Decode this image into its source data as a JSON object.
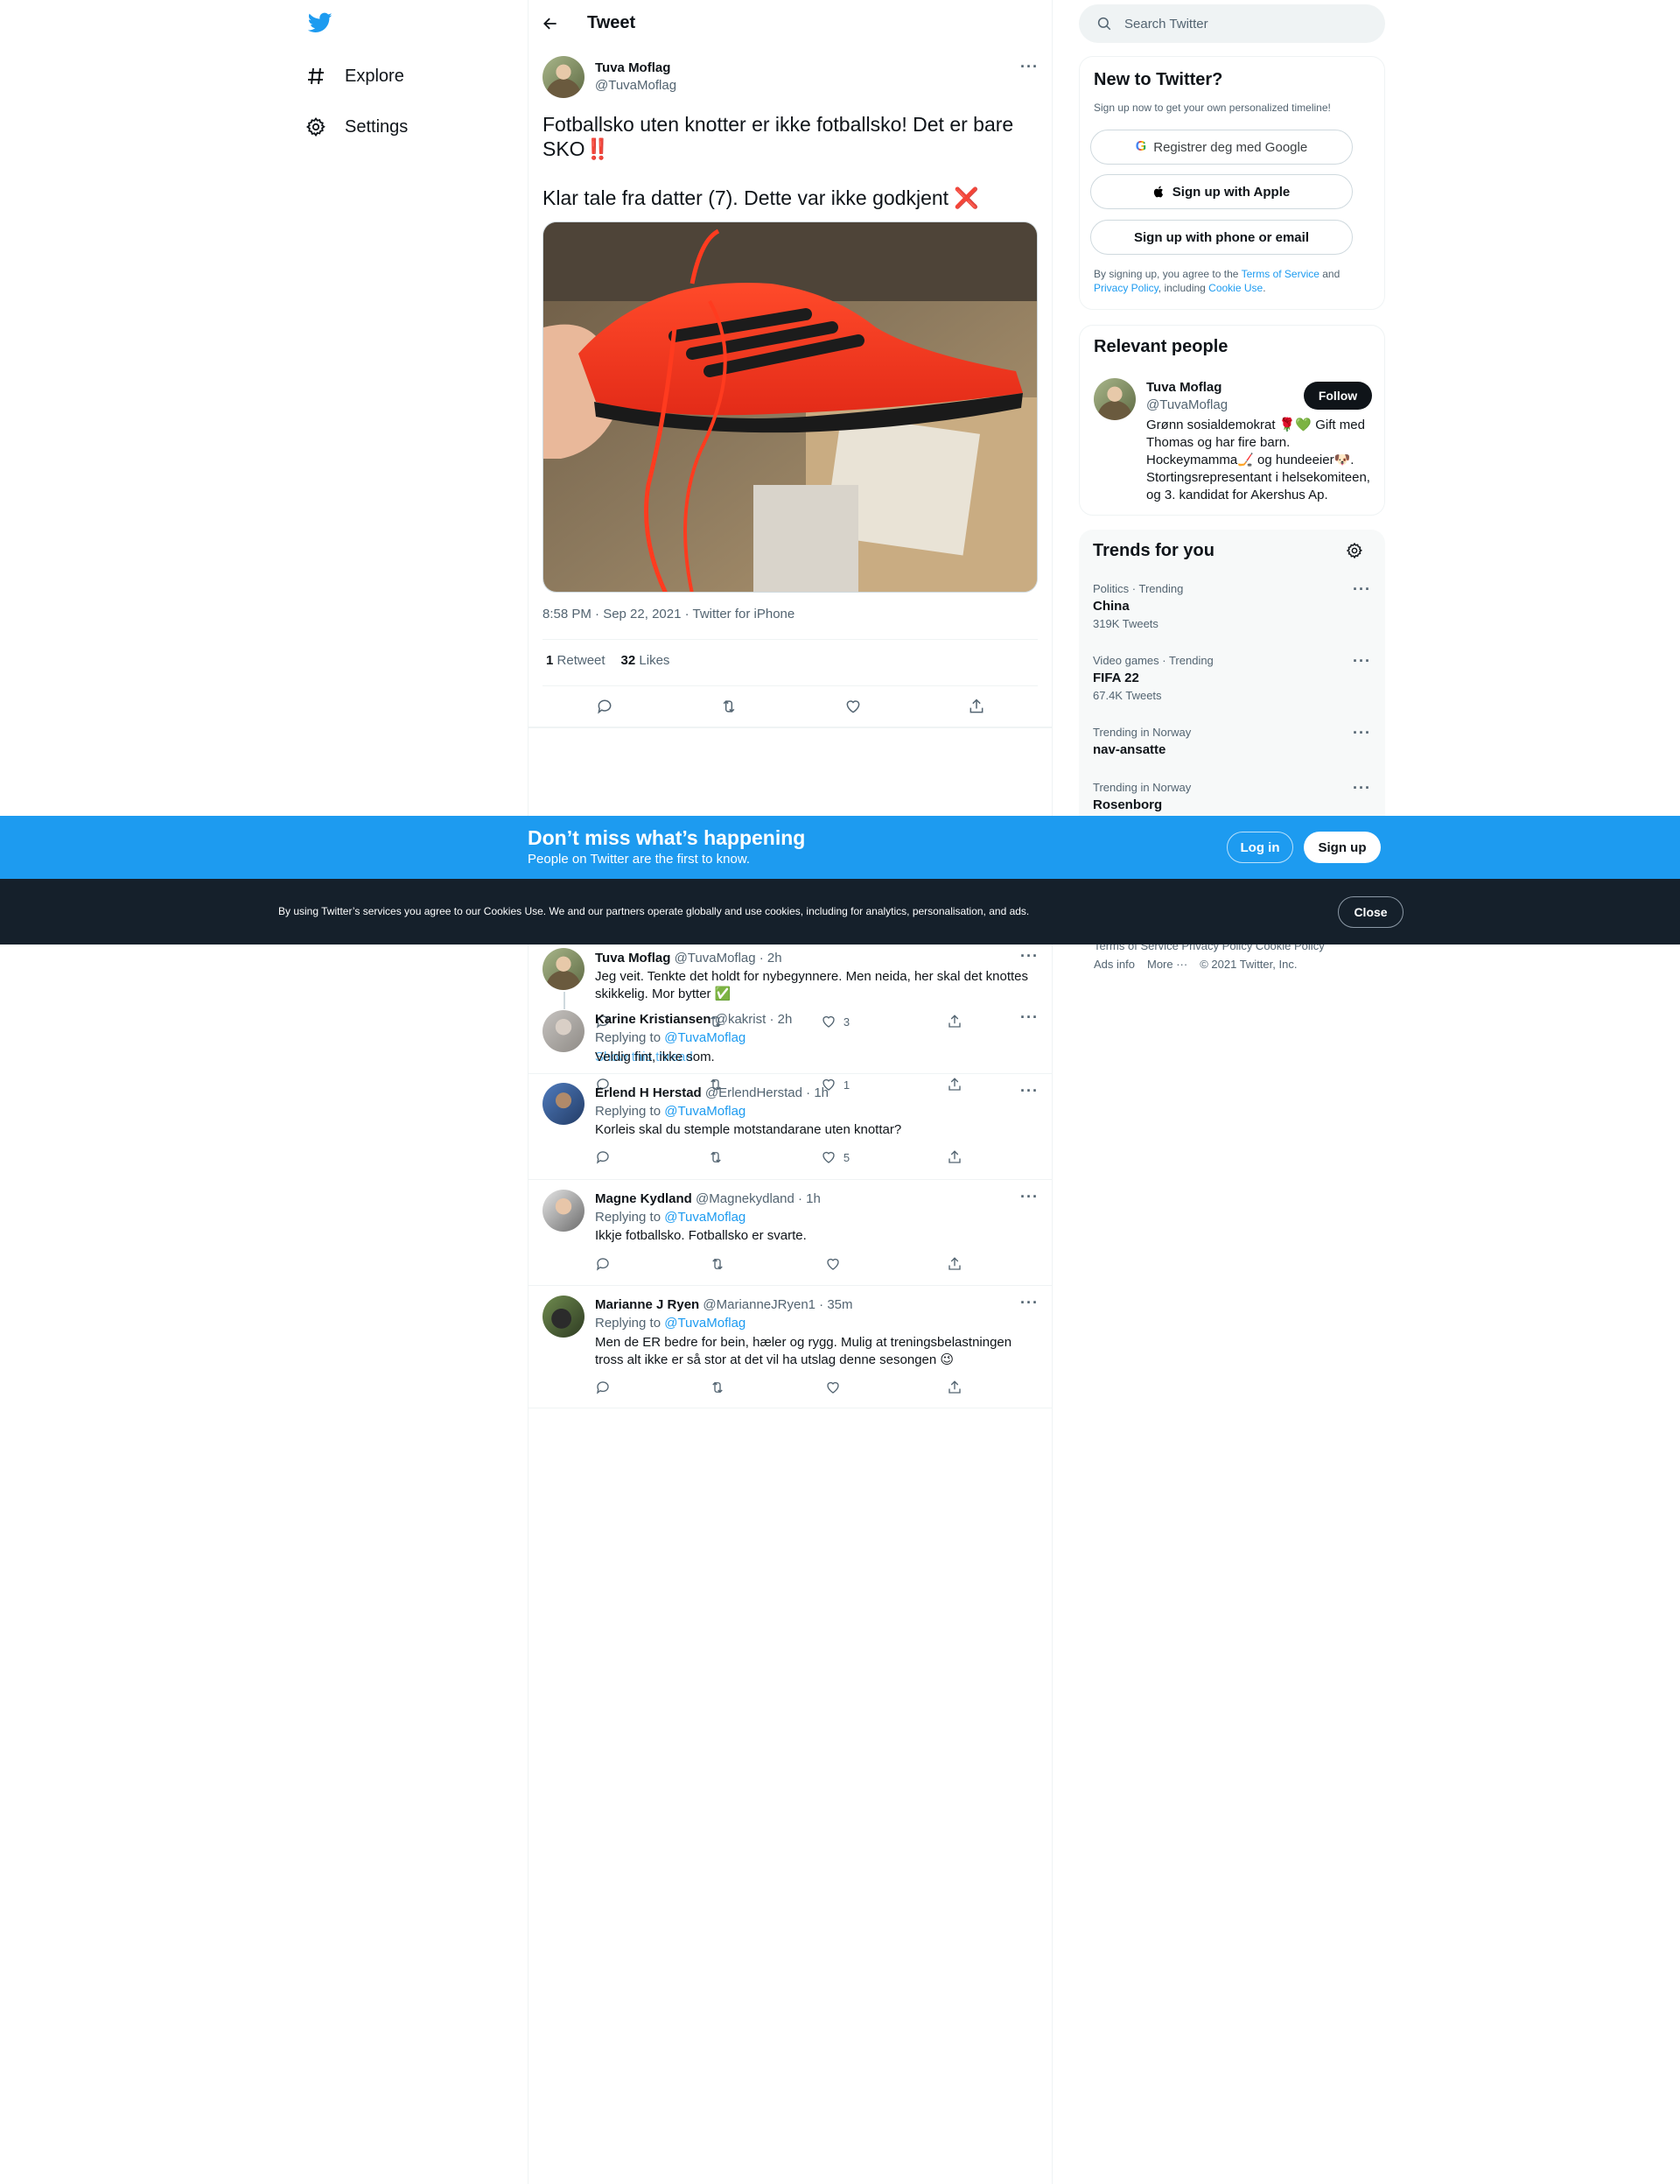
{
  "colors": {
    "accent": "#1d9bf0",
    "text": "#0f1419",
    "muted": "#536471",
    "dark_banner": "#15202b",
    "like_red": "#f91880"
  },
  "nav": {
    "logo_icon": "twitter-bird-icon",
    "items": [
      {
        "label": "Explore",
        "icon": "hashtag-icon"
      },
      {
        "label": "Settings",
        "icon": "gear-icon"
      }
    ]
  },
  "header": {
    "title": "Tweet",
    "back_icon": "back-arrow-icon"
  },
  "tweet": {
    "author_name": "Tuva Moflag",
    "author_handle": "@TuvaMoflag",
    "text_line1": "Fotballsko uten knotter er ikke fotballsko! Det er bare SKO‼️",
    "text_line2": "Klar tale fra datter (7). Dette var ikke godkjent ❌",
    "time": "8:58 PM · Sep 22, 2021 · Twitter for iPhone",
    "retweets_count": "1",
    "retweets_label": "Retweet",
    "likes_count": "32",
    "likes_label": "Likes",
    "image_alt": "Red football shoe held in a hand"
  },
  "replies": [
    {
      "name": "Tuva Moflag",
      "handle_time": "@TuvaMoflag · 2h",
      "replying_label": "",
      "replying_to": "",
      "text": "Jeg veit. Tenkte det holdt for nybegynnere. Men neida, her skal det knottes skikkelig. Mor bytter ✅",
      "likes": "3"
    },
    {
      "name": "Karine Kristiansen",
      "handle_time": "@kakrist · 2h",
      "replying_label": "Replying to",
      "replying_to": "@TuvaMoflag",
      "text": "Veldig fint, ikke som.",
      "overlap_text": "Show this thread",
      "likes": "1"
    },
    {
      "name": "Erlend H Herstad",
      "handle_time": "@ErlendHerstad · 1h",
      "replying_label": "Replying to",
      "replying_to": "@TuvaMoflag",
      "text": "Korleis skal du stemple motstandarane uten knottar?",
      "likes": "5"
    },
    {
      "name": "Magne Kydland",
      "handle_time": "@Magnekydland · 1h",
      "replying_label": "Replying to",
      "replying_to": "@TuvaMoflag",
      "text": "Ikkje fotballsko. Fotballsko er svarte.",
      "likes": ""
    },
    {
      "name": "Marianne J Ryen",
      "handle_time": "@MarianneJRyen1 · 35m",
      "replying_label": "Replying to",
      "replying_to": "@TuvaMoflag",
      "text": "Men de ER bedre for bein, hæler og rygg. Mulig at treningsbelastningen tross alt ikke er så stor at det vil ha utslag denne sesongen 😉",
      "likes": ""
    }
  ],
  "search": {
    "placeholder": "Search Twitter"
  },
  "signup": {
    "title": "New to Twitter?",
    "subtitle": "Sign up now to get your own personalized timeline!",
    "google": "Registrer deg med Google",
    "apple": "Sign up with Apple",
    "phone": "Sign up with phone or email",
    "terms_1": "By signing up, you agree to the ",
    "terms_tos": "Terms of Service",
    "terms_2": " and ",
    "terms_pp": "Privacy Policy",
    "terms_3": ", including ",
    "terms_cookie": "Cookie Use",
    "terms_4": "."
  },
  "relevant": {
    "title": "Relevant people",
    "name": "Tuva Moflag",
    "handle": "@TuvaMoflag",
    "follow": "Follow",
    "bio": "Grønn sosialdemokrat 🌹💚 Gift med Thomas og har fire barn. Hockeymamma🏒 og hundeeier🐶. Stortingsrepresentant i helsekomiteen, og 3. kandidat for Akershus Ap."
  },
  "trends": {
    "title": "Trends for you",
    "items": [
      {
        "category": "Politics · Trending",
        "name": "China",
        "count": "319K Tweets"
      },
      {
        "category": "Video games · Trending",
        "name": "FIFA 22",
        "count": "67.4K Tweets"
      },
      {
        "category": "Trending in Norway",
        "name": "nav-ansatte",
        "count": ""
      },
      {
        "category": "Trending in Norway",
        "name": "Rosenborg",
        "count": ""
      }
    ]
  },
  "footer": {
    "line1": "Terms of Service    Privacy Policy    Cookie Policy",
    "ads": "Ads info",
    "more": "More ···",
    "copy": "© 2021 Twitter, Inc."
  },
  "banner": {
    "title": "Don’t miss what’s happening",
    "subtitle": "People on Twitter are the first to know.",
    "login": "Log in",
    "signup": "Sign up"
  },
  "cookie": {
    "text": "By using Twitter’s services you agree to our Cookies Use. We and our partners operate globally and use cookies, including for analytics, personalisation, and ads.",
    "close": "Close"
  }
}
